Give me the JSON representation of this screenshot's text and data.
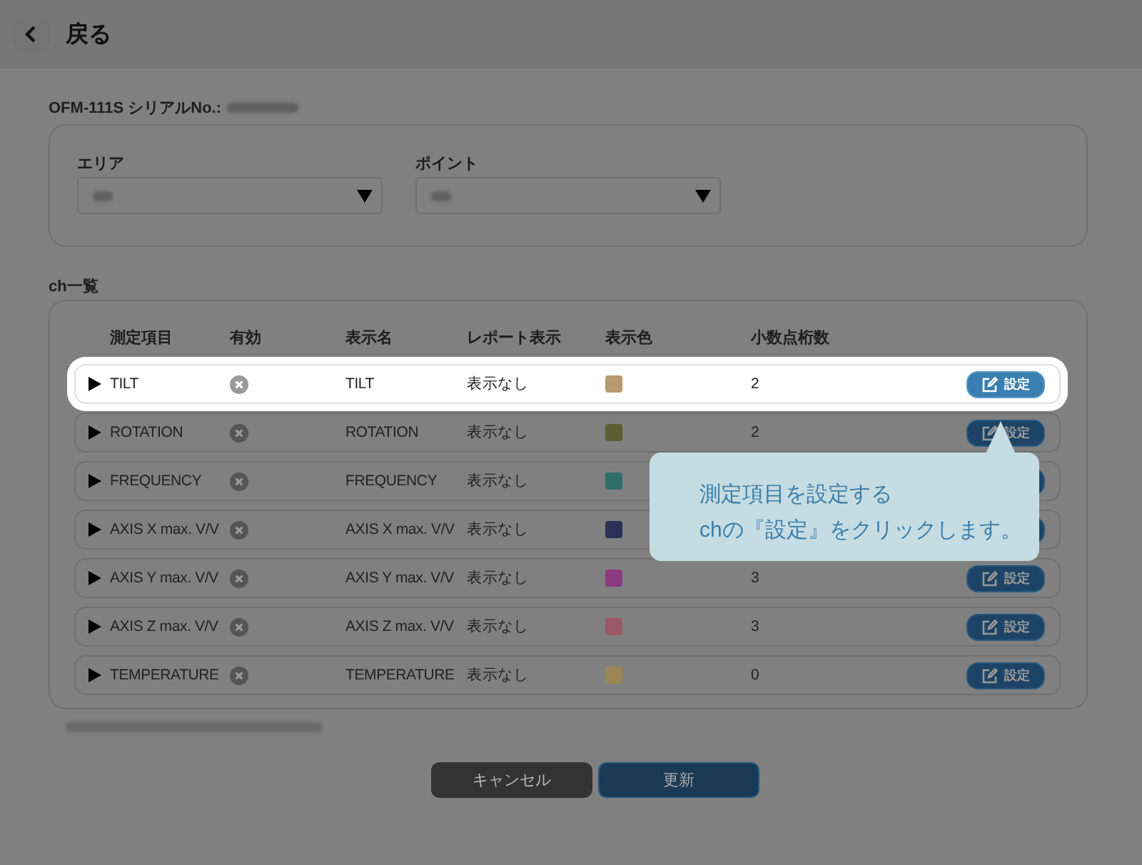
{
  "header": {
    "back_label": "戻る"
  },
  "device": {
    "label": "OFM-111S シリアルNo.:"
  },
  "filters": [
    {
      "label": "エリア"
    },
    {
      "label": "ポイント"
    }
  ],
  "channel_list": {
    "title": "ch一覧",
    "columns": [
      "測定項目",
      "有効",
      "表示名",
      "レポート表示",
      "表示色",
      "小数点桁数"
    ],
    "rows": [
      {
        "item": "TILT",
        "enabled": false,
        "display_name": "TILT",
        "report": "表示なし",
        "color": "#b89a70",
        "decimals": "2",
        "button": "設定",
        "highlighted": true
      },
      {
        "item": "ROTATION",
        "enabled": false,
        "display_name": "ROTATION",
        "report": "表示なし",
        "color": "#5b5d33",
        "decimals": "2",
        "button": "設定",
        "highlighted": false
      },
      {
        "item": "FREQUENCY",
        "enabled": false,
        "display_name": "FREQUENCY",
        "report": "表示なし",
        "color": "#2f6e66",
        "highlighted": false
      },
      {
        "item": "AXIS X max. V/V",
        "enabled": false,
        "display_name": "AXIS X max. V/V",
        "report": "表示なし",
        "color": "#2b3056",
        "highlighted": false
      },
      {
        "item": "AXIS Y max. V/V",
        "enabled": false,
        "display_name": "AXIS Y max. V/V",
        "report": "表示なし",
        "color": "#8a3b7e",
        "decimals": "3",
        "button": "設定",
        "highlighted": false
      },
      {
        "item": "AXIS Z max. V/V",
        "enabled": false,
        "display_name": "AXIS Z max. V/V",
        "report": "表示なし",
        "color": "#9a5868",
        "decimals": "3",
        "button": "設定",
        "highlighted": false
      },
      {
        "item": "TEMPERATURE",
        "enabled": false,
        "display_name": "TEMPERATURE",
        "report": "表示なし",
        "color": "#9a8657",
        "decimals": "0",
        "button": "設定",
        "highlighted": false
      }
    ]
  },
  "tooltip": {
    "lines": [
      "測定項目を設定する",
      "chの『設定』をクリックします。"
    ]
  },
  "buttons": [
    {
      "label": "キャンセル",
      "kind": "cancel"
    },
    {
      "label": "更新",
      "kind": "primary"
    }
  ]
}
